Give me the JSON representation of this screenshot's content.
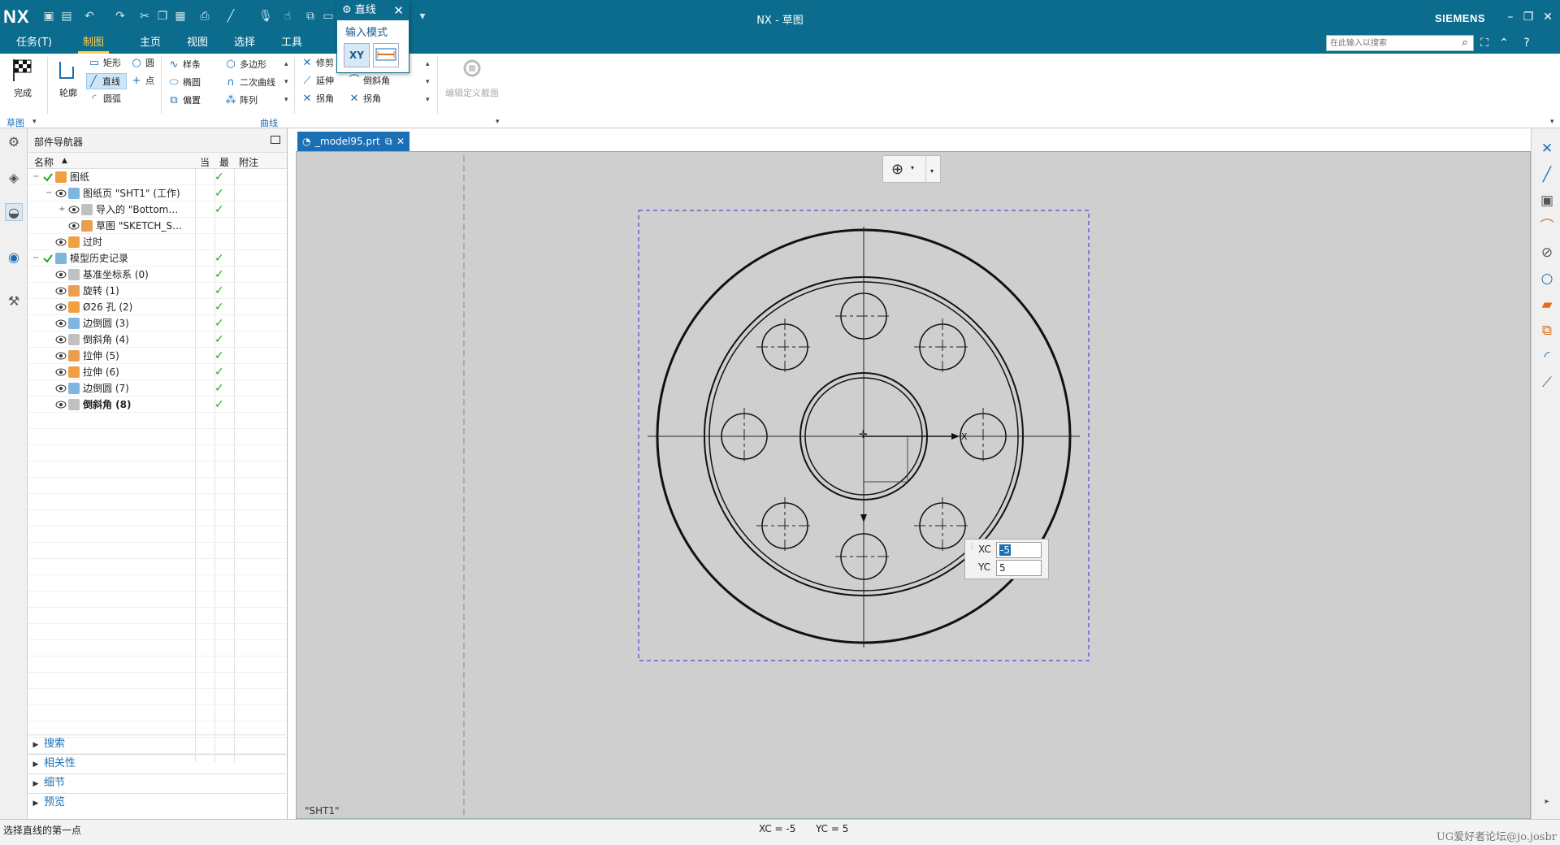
{
  "app": {
    "logo": "NX",
    "window_title": "NX - 草图",
    "brand": "SIEMENS"
  },
  "menu": {
    "tabs": [
      "任务(T)",
      "制图",
      "草图",
      "主页",
      "视图",
      "选择",
      "工具"
    ],
    "search_placeholder": "在此输入以搜索"
  },
  "line_dialog": {
    "title": "直线",
    "input_mode_label": "输入模式",
    "mode_xy": "XY",
    "mode_param": "参数模式"
  },
  "ribbon": {
    "finish_label": "完成",
    "profile_label": "轮廓",
    "items": {
      "rect": "矩形",
      "circle": "圆",
      "line": "直线",
      "point": "点",
      "arc": "圆弧",
      "spline": "样条",
      "polygon": "多边形",
      "ellipse": "椭圆",
      "conic": "二次曲线",
      "offset": "偏置",
      "pattern": "阵列",
      "trim": "修剪",
      "extend": "延伸",
      "corner": "拐角",
      "fillet": "圆角",
      "chamfer": "倒斜角",
      "corner2": "拐角",
      "edit_section": "编辑定义截面"
    },
    "group_sketch": "草图",
    "group_curve": "曲线"
  },
  "navigator": {
    "title": "部件导航器",
    "columns": [
      "名称",
      "当",
      "最",
      "附注"
    ],
    "rows": [
      {
        "label": "图纸",
        "indent": 0,
        "check": true,
        "expand": "-"
      },
      {
        "label": "图纸页 \"SHT1\" (工作)",
        "indent": 1,
        "check": true,
        "expand": "-"
      },
      {
        "label": "导入的 \"Bottom…",
        "indent": 2,
        "check": true,
        "expand": "+"
      },
      {
        "label": "草图 \"SKETCH_S…",
        "indent": 2,
        "check": false,
        "expand": ""
      },
      {
        "label": "过时",
        "indent": 1,
        "check": false,
        "expand": ""
      },
      {
        "label": "模型历史记录",
        "indent": 0,
        "check": true,
        "expand": "-"
      },
      {
        "label": "基准坐标系 (0)",
        "indent": 1,
        "check": true,
        "expand": ""
      },
      {
        "label": "旋转 (1)",
        "indent": 1,
        "check": true,
        "expand": ""
      },
      {
        "label": "Ø26 孔 (2)",
        "indent": 1,
        "check": true,
        "expand": ""
      },
      {
        "label": "边倒圆 (3)",
        "indent": 1,
        "check": true,
        "expand": ""
      },
      {
        "label": "倒斜角 (4)",
        "indent": 1,
        "check": true,
        "expand": ""
      },
      {
        "label": "拉伸 (5)",
        "indent": 1,
        "check": true,
        "expand": ""
      },
      {
        "label": "拉伸 (6)",
        "indent": 1,
        "check": true,
        "expand": ""
      },
      {
        "label": "边倒圆 (7)",
        "indent": 1,
        "check": true,
        "expand": ""
      },
      {
        "label": "倒斜角 (8)",
        "indent": 1,
        "check": true,
        "expand": "",
        "bold": true
      }
    ],
    "sections": [
      "搜索",
      "相关性",
      "细节",
      "预览"
    ]
  },
  "document": {
    "tab_label": "_model95.prt",
    "sheet_label": "\"SHT1\"",
    "axis_label": "X"
  },
  "coord_input": {
    "xc_label": "XC",
    "xc_value": "-5",
    "yc_label": "YC",
    "yc_value": "5"
  },
  "status": {
    "message": "选择直线的第一点",
    "xc": "XC = -5",
    "yc": "YC = 5",
    "watermark": "UG爱好者论坛@jo.josbr"
  },
  "colors": {
    "title_bar": "#0b6c8e",
    "accent": "#1a6fb5",
    "active_tab": "#ffcf4d",
    "check_green": "#2aa52a",
    "canvas": "#cfcfcf",
    "sheet_border": "#2b2bd6"
  }
}
